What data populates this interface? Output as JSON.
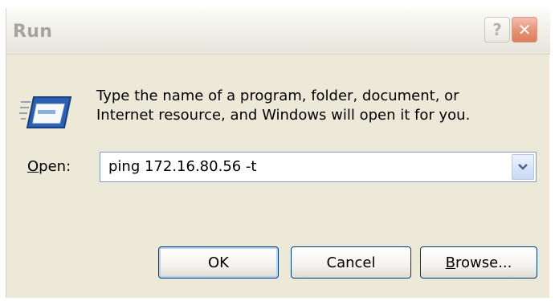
{
  "window": {
    "title": "Run"
  },
  "titlebar": {
    "help_label": "?",
    "close_label": "✕"
  },
  "description": {
    "line1": "Type the name of a program, folder, document, or",
    "line2": "Internet resource, and Windows will open it for you."
  },
  "open_field": {
    "label_mnemonic": "O",
    "label_rest": "pen:",
    "value": "ping 172.16.80.56 -t"
  },
  "buttons": {
    "ok_label": "OK",
    "cancel_label": "Cancel",
    "browse_mnemonic": "B",
    "browse_rest": "rowse..."
  },
  "icons": {
    "run": "run-program-icon",
    "dropdown": "chevron-down-icon",
    "help": "help-icon",
    "close": "close-icon"
  }
}
